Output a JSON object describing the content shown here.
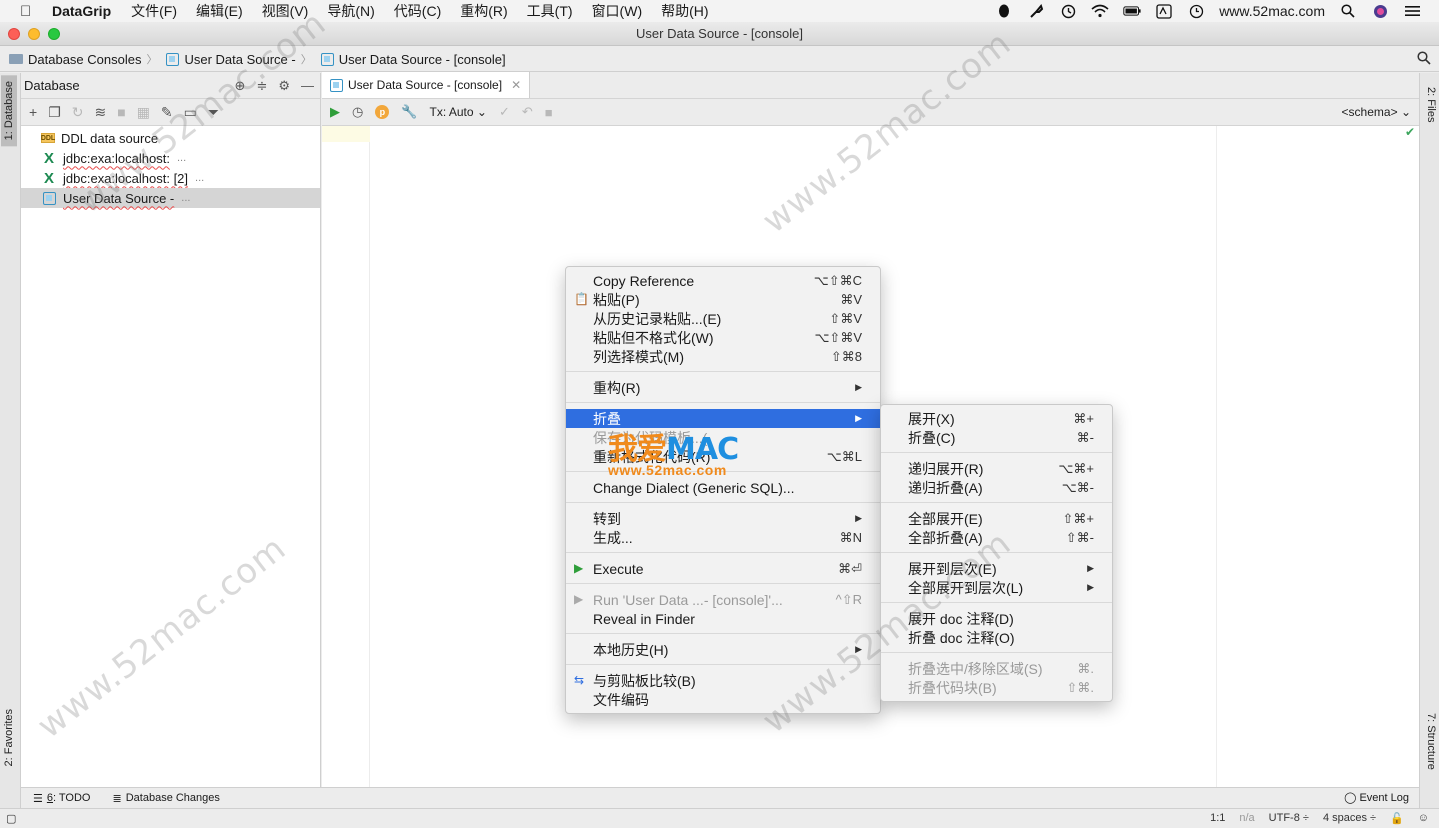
{
  "menubar": {
    "app_name": "DataGrip",
    "items": [
      "文件(F)",
      "编辑(E)",
      "视图(V)",
      "导航(N)",
      "代码(C)",
      "重构(R)",
      "工具(T)",
      "窗口(W)",
      "帮助(H)"
    ],
    "url": "www.52mac.com"
  },
  "window": {
    "title": "User Data Source - [console]"
  },
  "breadcrumb": [
    "Database Consoles",
    "User Data Source -",
    "User Data Source - [console]"
  ],
  "left_strip": {
    "database_tab": "1: Database",
    "favorites_tab": "2: Favorites"
  },
  "right_strip": {
    "files_tab": "2: Files",
    "structure_tab": "7: Structure"
  },
  "db_panel": {
    "title": "Database",
    "nodes": [
      {
        "label": "DDL data source",
        "more": ""
      },
      {
        "label": "jdbc:exa:localhost:",
        "more": "..."
      },
      {
        "label": "jdbc:exa:localhost: [2]",
        "more": "..."
      },
      {
        "label": "User Data Source -",
        "more": "..."
      }
    ]
  },
  "editor": {
    "tab_label": "User Data Source - [console]",
    "tx_label": "Tx: Auto",
    "schema_label": "<schema>"
  },
  "context_menu": {
    "copy_reference": "Copy Reference",
    "copy_reference_sc": "⌥⇧⌘C",
    "paste": "粘贴(P)",
    "paste_sc": "⌘V",
    "paste_history": "从历史记录粘贴...(E)",
    "paste_history_sc": "⇧⌘V",
    "paste_plain": "粘贴但不格式化(W)",
    "paste_plain_sc": "⌥⇧⌘V",
    "column_mode": "列选择模式(M)",
    "column_mode_sc": "⇧⌘8",
    "refactor": "重构(R)",
    "folding": "折叠",
    "save_template": "保存为代码模板...(",
    "reformat": "重新格式化代码(R)",
    "reformat_sc": "⌥⌘L",
    "change_dialect": "Change Dialect (Generic SQL)...",
    "goto": "转到",
    "generate": "生成...",
    "generate_sc": "⌘N",
    "execute": "Execute",
    "execute_sc": "⌘⏎",
    "run": "Run 'User Data ...- [console]'...",
    "run_sc": "^⇧R",
    "reveal": "Reveal in Finder",
    "local_history": "本地历史(H)",
    "compare_clipboard": "与剪贴板比较(B)",
    "file_encoding": "文件编码"
  },
  "folding_submenu": {
    "expand": "展开(X)",
    "expand_sc": "⌘+",
    "collapse": "折叠(C)",
    "collapse_sc": "⌘-",
    "expand_recursive": "递归展开(R)",
    "expand_recursive_sc": "⌥⌘+",
    "collapse_recursive": "递归折叠(A)",
    "collapse_recursive_sc": "⌥⌘-",
    "expand_all": "全部展开(E)",
    "expand_all_sc": "⇧⌘+",
    "collapse_all": "全部折叠(A)",
    "collapse_all_sc": "⇧⌘-",
    "expand_level": "展开到层次(E)",
    "expand_all_level": "全部展开到层次(L)",
    "expand_doc": "展开 doc 注释(D)",
    "collapse_doc": "折叠 doc 注释(O)",
    "fold_selection": "折叠选中/移除区域(S)",
    "fold_selection_sc": "⌘.",
    "fold_block": "折叠代码块(B)",
    "fold_block_sc": "⇧⌘."
  },
  "bottom_tools": {
    "todo_num": "6",
    "todo_label": ": TODO",
    "db_changes": "Database Changes",
    "event_log": "Event Log"
  },
  "status": {
    "position": "1:1",
    "na": "n/a",
    "encoding": "UTF-8 ÷",
    "indent": "4 spaces ÷"
  },
  "watermark": {
    "text": "www.52mac.com",
    "logo_a": "我爱",
    "logo_b": "MAC",
    "logo_url": "www.52mac.com"
  }
}
